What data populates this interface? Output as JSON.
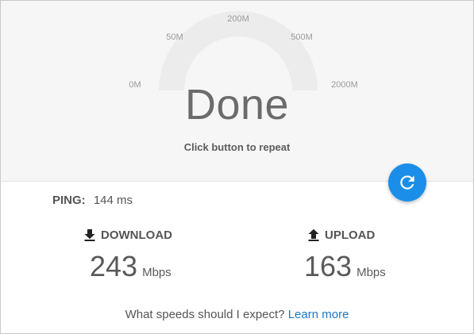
{
  "gauge": {
    "ticks": [
      "0M",
      "50M",
      "200M",
      "500M",
      "2000M"
    ],
    "status": "Done",
    "hint": "Click button to repeat"
  },
  "repeat_button": {
    "icon": "refresh-icon",
    "color": "#1a8ee8"
  },
  "ping": {
    "label": "PING:",
    "value": "144 ms"
  },
  "download": {
    "icon": "download-arrow-icon",
    "label": "DOWNLOAD",
    "value": "243",
    "unit": "Mbps"
  },
  "upload": {
    "icon": "upload-arrow-icon",
    "label": "UPLOAD",
    "value": "163",
    "unit": "Mbps"
  },
  "footer": {
    "question": "What speeds should I expect?",
    "link": "Learn more"
  },
  "colors": {
    "accent": "#1a8ee8",
    "link": "#1a79c8",
    "panel_bg": "#f6f6f6"
  }
}
